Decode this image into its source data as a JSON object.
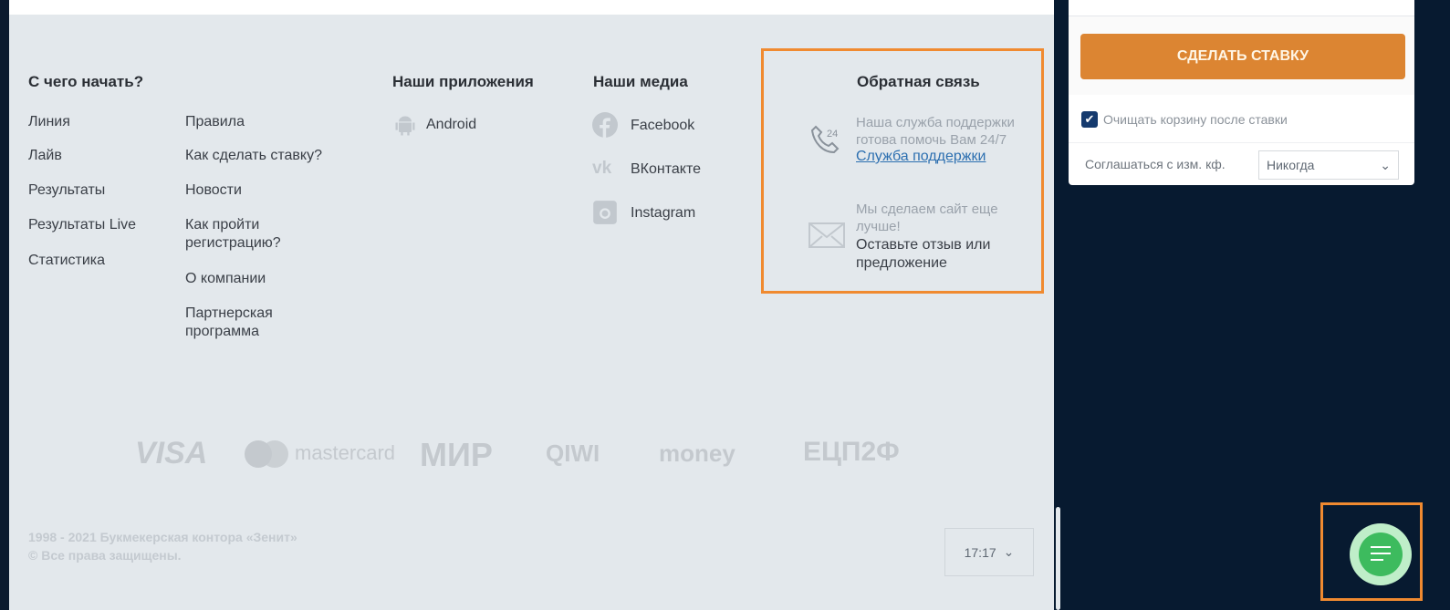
{
  "footer": {
    "start": {
      "title": "С чего начать?",
      "col1": [
        "Линия",
        "Лайв",
        "Результаты",
        "Результаты Live",
        "Статистика"
      ],
      "col2": [
        "Правила",
        "Как сделать ставку?",
        "Новости",
        "Как пройти регистрацию?",
        "О компании",
        "Партнерская программа"
      ]
    },
    "apps": {
      "title": "Наши приложения",
      "items": [
        {
          "label": "Android",
          "icon": "android-icon"
        }
      ]
    },
    "media": {
      "title": "Наши медиа",
      "items": [
        {
          "label": "Facebook",
          "icon": "facebook-icon"
        },
        {
          "label": "ВКонтакте",
          "icon": "vk-icon"
        },
        {
          "label": "Instagram",
          "icon": "instagram-icon"
        }
      ]
    },
    "feedback": {
      "title": "Обратная связь",
      "support_text": "Наша служба поддержки готова помочь Вам 24/7",
      "support_link": "Служба поддержки",
      "improve_text": "Мы сделаем сайт еще лучше!",
      "improve_link": "Оставьте отзыв или предложение"
    },
    "payments": [
      "VISA",
      "mastercard",
      "МИР",
      "QIWI",
      "money",
      "ЕЦП2Ф"
    ],
    "copyright1": "1998 - 2021 Букмекерская контора «Зенит»",
    "copyright2": "© Все права защищены.",
    "time": "17:17"
  },
  "betslip": {
    "make_bet": "СДЕЛАТЬ СТАВКУ",
    "clear_label": "Очищать корзину после ставки",
    "clear_checked": true,
    "accept_label": "Соглашаться с изм. кф.",
    "accept_value": "Никогда"
  },
  "colors": {
    "accent": "#dc8532",
    "highlight": "#f08a30",
    "chat": "#3dbb5e",
    "dark": "#071a30"
  }
}
